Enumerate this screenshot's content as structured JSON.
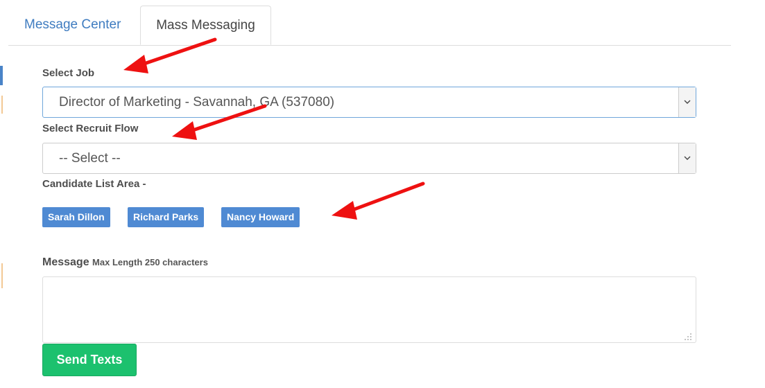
{
  "tabs": [
    {
      "label": "Message Center",
      "active": false
    },
    {
      "label": "Mass Messaging",
      "active": true
    }
  ],
  "form": {
    "job_label": "Select Job",
    "job_value": "Director of Marketing - Savannah, GA (537080)",
    "flow_label": "Select Recruit Flow",
    "flow_value": "-- Select --",
    "candidates_label": "Candidate List Area -",
    "candidates": [
      "Sarah Dillon",
      "Richard Parks",
      "Nancy Howard"
    ],
    "message_label": "Message",
    "message_hint": "Max Length 250 characters",
    "message_value": "",
    "send_label": "Send Texts"
  },
  "icons": {
    "select_arrow": "chevron-down-icon",
    "annotation": "red-arrow-icon",
    "resize": "resize-grip-icon"
  },
  "colors": {
    "tab_link": "#3f7cc0",
    "chip": "#4f8ad3",
    "send_button": "#1cc16e",
    "annotation_arrow": "#ee1111"
  }
}
